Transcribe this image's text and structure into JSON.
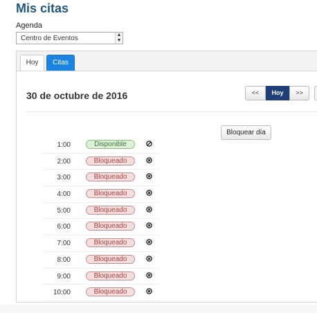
{
  "page_title": "Mis citas",
  "agenda": {
    "label": "Agenda",
    "selected": "Centro de Eventos"
  },
  "tabs": [
    {
      "label": "Hoy",
      "active": false
    },
    {
      "label": "Citas",
      "active": true
    }
  ],
  "date_heading": "30 de octubre de 2016",
  "nav": {
    "prev": "<<",
    "today": "Hoy",
    "next": ">>"
  },
  "block_day_label": "Bloquear día",
  "slots": [
    {
      "time": "1:00",
      "status": "Disponible",
      "icon": "block-icon"
    },
    {
      "time": "2:00",
      "status": "Bloqueado",
      "icon": "unblock-x-icon"
    },
    {
      "time": "3:00",
      "status": "Bloqueado",
      "icon": "unblock-x-icon"
    },
    {
      "time": "4:00",
      "status": "Bloqueado",
      "icon": "unblock-x-icon"
    },
    {
      "time": "5:00",
      "status": "Bloqueado",
      "icon": "unblock-x-icon"
    },
    {
      "time": "6:00",
      "status": "Bloqueado",
      "icon": "unblock-x-icon"
    },
    {
      "time": "7:00",
      "status": "Bloqueado",
      "icon": "unblock-x-icon"
    },
    {
      "time": "8:00",
      "status": "Bloqueado",
      "icon": "unblock-x-icon"
    },
    {
      "time": "9:00",
      "status": "Bloqueado",
      "icon": "unblock-x-icon"
    },
    {
      "time": "10:00",
      "status": "Bloqueado",
      "icon": "unblock-x-icon"
    }
  ],
  "colors": {
    "title": "#22577a",
    "active_tab": "#1a84e0",
    "today_button": "#1e3f78",
    "available_bg": "#dff0d8",
    "blocked_bg": "#f2dede"
  }
}
